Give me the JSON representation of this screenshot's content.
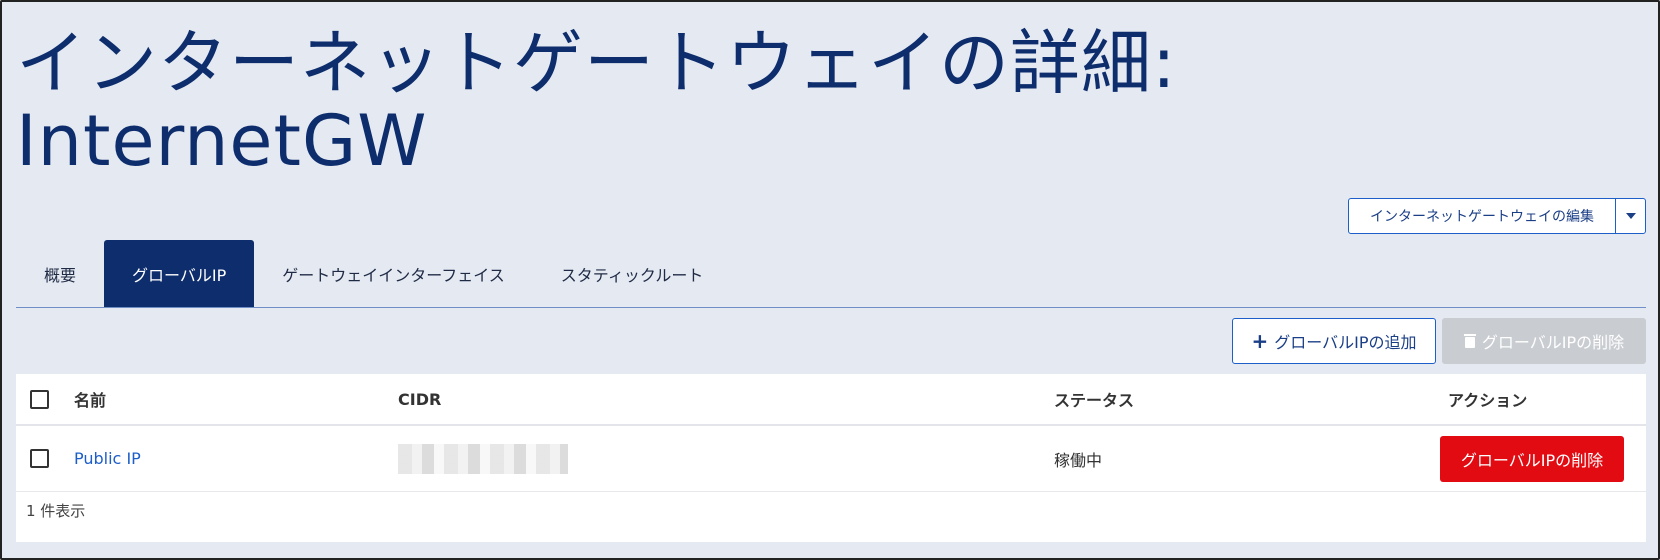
{
  "page": {
    "title_line1": "インターネットゲートウェイの詳細:",
    "title_line2": "InternetGW"
  },
  "edit_button": {
    "label": "インターネットゲートウェイの編集",
    "caret_icon": "chevron-down-icon"
  },
  "tabs": [
    {
      "label": "概要",
      "active": false
    },
    {
      "label": "グローバルIP",
      "active": true
    },
    {
      "label": "ゲートウェイインターフェイス",
      "active": false
    },
    {
      "label": "スタティックルート",
      "active": false
    }
  ],
  "toolbar": {
    "add_label": "グローバルIPの追加",
    "add_icon": "plus-icon",
    "delete_label": "グローバルIPの削除",
    "delete_icon": "trash-icon"
  },
  "table": {
    "columns": [
      "名前",
      "CIDR",
      "ステータス",
      "アクション"
    ],
    "rows": [
      {
        "name": "Public IP",
        "cidr": "",
        "status": "稼働中",
        "action_label": "グローバルIPの削除"
      }
    ],
    "footer": "1 件表示"
  },
  "colors": {
    "background": "#e4e9f2",
    "title": "#0d2d6c",
    "active_tab": "#0d2d6c",
    "link": "#1d5ec8",
    "danger": "#e20b12",
    "disabled": "#c9ccd1"
  }
}
